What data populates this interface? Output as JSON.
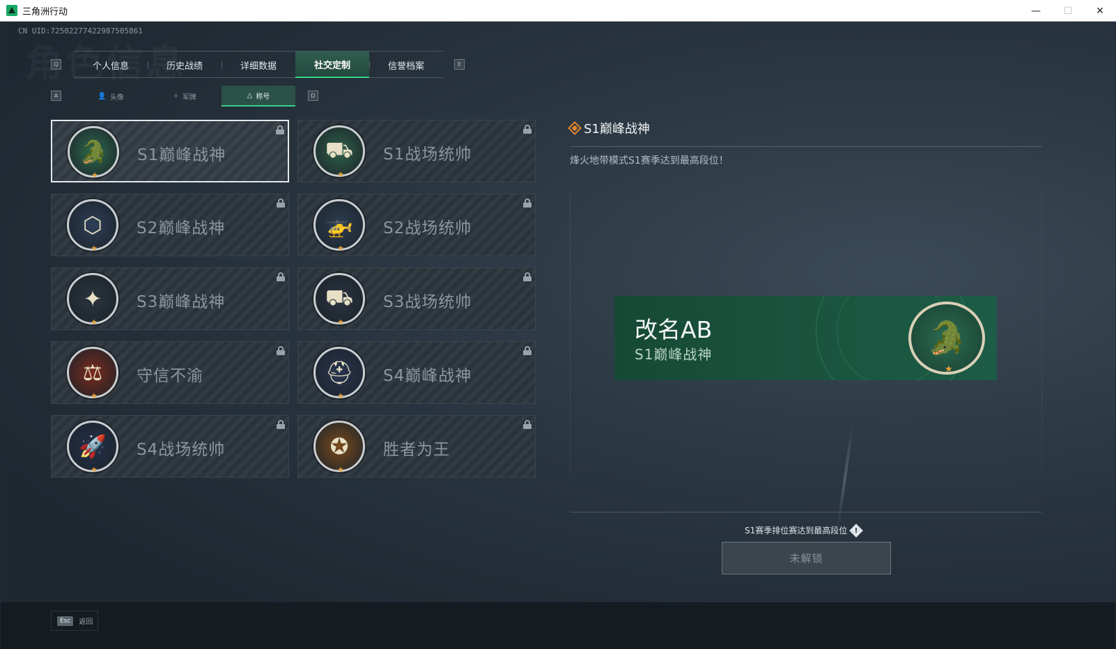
{
  "window": {
    "title": "三角洲行动",
    "minimize": "—",
    "maximize": "☐",
    "close": "✕"
  },
  "header": {
    "uid": "CN UID:7250227742298750586​1",
    "bg_title": "角色信息"
  },
  "keyhints": {
    "prev_main": "Q",
    "next_main": "E",
    "prev_sub": "A",
    "next_sub": "D"
  },
  "main_tabs": [
    {
      "label": "个人信息",
      "active": false
    },
    {
      "label": "历史战绩",
      "active": false
    },
    {
      "label": "详细数据",
      "active": false
    },
    {
      "label": "社交定制",
      "active": true
    },
    {
      "label": "信誉档案",
      "active": false
    }
  ],
  "sub_tabs": [
    {
      "label": "头像",
      "icon": "person-icon",
      "active": false
    },
    {
      "label": "军牌",
      "icon": "dogtag-icon",
      "active": false
    },
    {
      "label": "称号",
      "icon": "triangle-icon",
      "active": true
    }
  ],
  "titles": [
    {
      "label": "S1巅峰战神",
      "icon": "crocodile-icon",
      "glyph": "🐊",
      "badge_bg": "#2e6a4c",
      "locked": true,
      "selected": true
    },
    {
      "label": "S1战场统帅",
      "icon": "tank-icon",
      "glyph": "⛟",
      "badge_bg": "#2f6248",
      "locked": true,
      "selected": false
    },
    {
      "label": "S2巅峰战神",
      "icon": "hexagon-emblem-icon",
      "glyph": "⬡",
      "badge_bg": "#2e3f58",
      "locked": true,
      "selected": false
    },
    {
      "label": "S2战场统帅",
      "icon": "helicopter-icon",
      "glyph": "🚁",
      "badge_bg": "#2d3d52",
      "locked": true,
      "selected": false
    },
    {
      "label": "S3巅峰战神",
      "icon": "globe-emblem-icon",
      "glyph": "✦",
      "badge_bg": "#2b333d",
      "locked": true,
      "selected": false
    },
    {
      "label": "S3战场统帅",
      "icon": "armored-vehicle-icon",
      "glyph": "⛟",
      "badge_bg": "#2a3440",
      "locked": true,
      "selected": false
    },
    {
      "label": "守信不渝",
      "icon": "scales-icon",
      "glyph": "⚖",
      "badge_bg": "#7a2a1c",
      "locked": true,
      "selected": false
    },
    {
      "label": "S4巅峰战神",
      "icon": "helmet-icon",
      "glyph": "⛑",
      "badge_bg": "#2a3550",
      "locked": true,
      "selected": false
    },
    {
      "label": "S4战场统帅",
      "icon": "missile-icon",
      "glyph": "🚀",
      "badge_bg": "#23304a",
      "locked": true,
      "selected": false
    },
    {
      "label": "胜者为王",
      "icon": "medal-icon",
      "glyph": "✪",
      "badge_bg": "#7a4a1c",
      "locked": true,
      "selected": false
    }
  ],
  "detail": {
    "title": "S1巅峰战神",
    "description": "烽火地带模式S1赛季达到最高段位！",
    "banner_name": "改名AB",
    "banner_title": "S1巅峰战神",
    "banner_glyph": "🐊",
    "unlock_condition": "S1赛季排位赛达到最高段位",
    "info_glyph": "!",
    "unlock_button": "未解锁"
  },
  "footer": {
    "esc_key": "Esc",
    "esc_label": "返回"
  },
  "colors": {
    "accent": "#36d08c",
    "star": "#e8a23a",
    "diamond": "#e8872e"
  }
}
